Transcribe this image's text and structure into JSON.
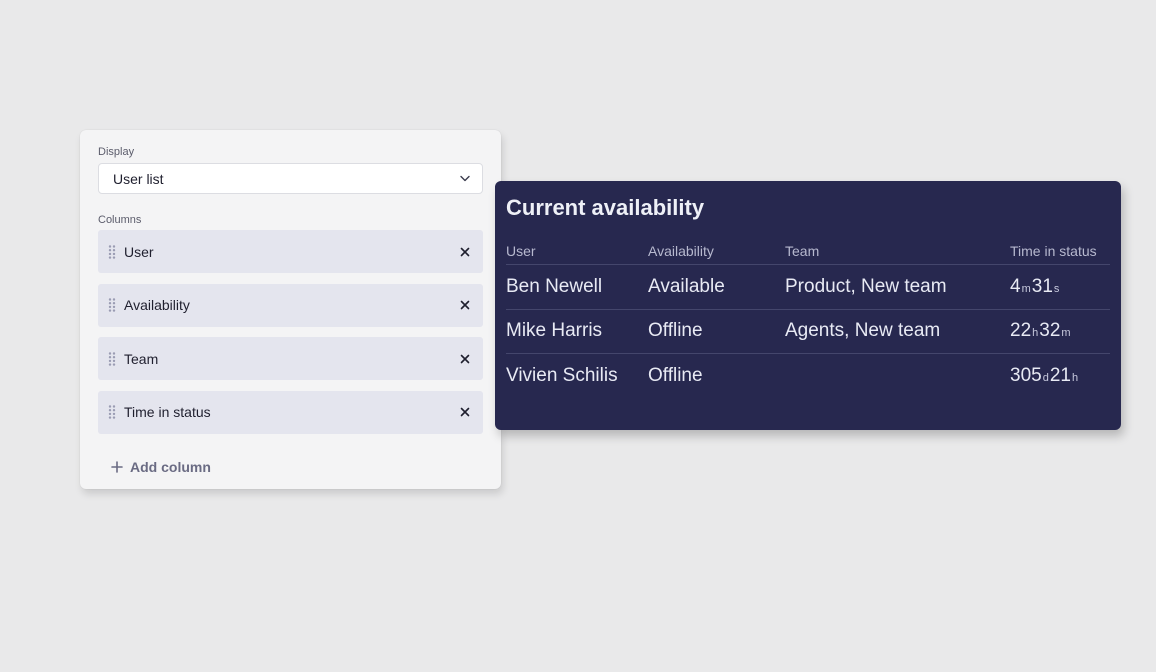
{
  "config": {
    "display_label": "Display",
    "display_value": "User list",
    "columns_label": "Columns",
    "columns": [
      {
        "label": "User"
      },
      {
        "label": "Availability"
      },
      {
        "label": "Team"
      },
      {
        "label": "Time in status"
      }
    ],
    "add_column_label": "Add column",
    "icons": {
      "drag": "drag-handle-icon",
      "remove": "close-icon",
      "add": "plus-icon",
      "select": "chevron-down-icon"
    }
  },
  "card": {
    "title": "Current availability",
    "headers": [
      "User",
      "Availability",
      "Team",
      "Time in status"
    ],
    "rows": [
      {
        "user": "Ben Newell",
        "availability": "Available",
        "team": "Product, New team",
        "time": {
          "v1": "4",
          "u1": "m",
          "v2": "31",
          "u2": "s"
        }
      },
      {
        "user": "Mike Harris",
        "availability": "Offline",
        "team": "Agents, New team",
        "time": {
          "v1": "22",
          "u1": "h",
          "v2": "32",
          "u2": "m"
        }
      },
      {
        "user": "Vivien Schilis",
        "availability": "Offline",
        "team": "",
        "time": {
          "v1": "305",
          "u1": "d",
          "v2": "21",
          "u2": "h"
        }
      }
    ]
  },
  "colors": {
    "card_background": "#27284f",
    "column_item_background": "#e4e5ee",
    "page_background": "#e9e9ea"
  }
}
